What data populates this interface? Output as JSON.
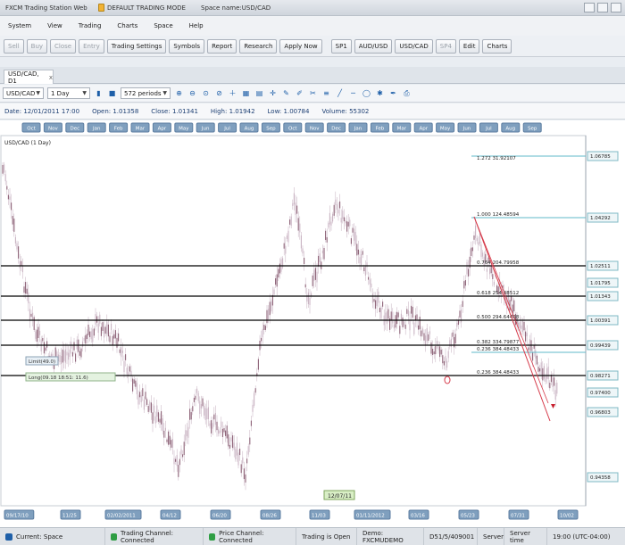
{
  "titlebar": {
    "app_title": "FXCM Trading Station Web",
    "mode": "DEFAULT TRADING MODE",
    "space_name": "Space name:USD/CAD"
  },
  "menu": [
    "System",
    "View",
    "Trading",
    "Charts",
    "Space",
    "Help"
  ],
  "toolbar": [
    {
      "label": "Sell",
      "disabled": true
    },
    {
      "label": "Buy",
      "disabled": true
    },
    {
      "label": "Close",
      "disabled": true
    },
    {
      "label": "Entry",
      "disabled": true
    },
    {
      "label": "Trading Settings",
      "disabled": false
    },
    {
      "label": "Symbols",
      "disabled": false
    },
    {
      "label": "Report",
      "disabled": false
    },
    {
      "label": "Research",
      "disabled": false
    },
    {
      "label": "Apply Now",
      "disabled": false
    },
    {
      "label": "SP1",
      "disabled": false
    },
    {
      "label": "AUD/USD",
      "disabled": false
    },
    {
      "label": "USD/CAD",
      "disabled": false
    },
    {
      "label": "SP4",
      "disabled": true
    },
    {
      "label": "Edit",
      "disabled": false
    },
    {
      "label": "Charts",
      "disabled": false
    }
  ],
  "chart_tab": {
    "label": "USD/CAD, D1",
    "close": "x"
  },
  "chart_controls": {
    "symbol": "USD/CAD",
    "timeframe": "1 Day",
    "periods": "572 periods"
  },
  "info": {
    "date": "Date: 12/01/2011 17:00",
    "open": "Open: 1.01358",
    "close": "Close: 1.01341",
    "high": "High: 1.01942",
    "low": "Low: 1.00784",
    "volume": "Volume: 55302"
  },
  "chart_label": "USD/CAD (1 Day)",
  "marker_date": "12/07/11",
  "price_labels": [
    "1.06785",
    "1.04292",
    "1.02511",
    "1.01795",
    "1.01343",
    "1.00391",
    "0.99439",
    "0.98271",
    "0.97400",
    "0.96803",
    "0.94358"
  ],
  "fib_labels": [
    "1.272 31.92107",
    "1.000 124.48594",
    "0.764 204.79958",
    "0.618 254.48512",
    "0.500 294.64468",
    "0.382 334.79877",
    "0.236 384.48433"
  ],
  "order_labels": {
    "limit": "Limit(49.0)",
    "long": "Long(09.18 18:51: 11.6)"
  },
  "month_labels": [
    "Oct",
    "Nov",
    "Dec",
    "Jan",
    "Feb",
    "Mar",
    "Apr",
    "May",
    "Jun",
    "Jul",
    "Aug",
    "Sep",
    "Oct",
    "Nov",
    "Dec",
    "Jan",
    "Feb",
    "Mar",
    "Apr",
    "May",
    "Jun",
    "Jul",
    "Aug",
    "Sep"
  ],
  "date_labels": [
    "09/17/10",
    "11/25",
    "02/02/2011",
    "04/12",
    "06/20",
    "08/26",
    "11/03",
    "01/11/2012",
    "03/16",
    "05/23",
    "07/31",
    "10/02"
  ],
  "status": {
    "space": "Current: Space",
    "trading_channel": "Trading Channel: Connected",
    "price_channel": "Price Channel: Connected",
    "trading_open": "Trading is Open",
    "account": "Demo: FXCMUDEMO",
    "balance": "D51/5/409001",
    "server": "Server",
    "server_time_label": "Server time",
    "time": "19:00 (UTC-04:00)"
  },
  "colors": {
    "accent": "#1e5fa8",
    "candle_up": "#c9b3c3",
    "candle_down": "#8c6177",
    "fib_line": "#000000",
    "trend_line": "#d63a4a",
    "level_line": "#5fb9c9"
  }
}
